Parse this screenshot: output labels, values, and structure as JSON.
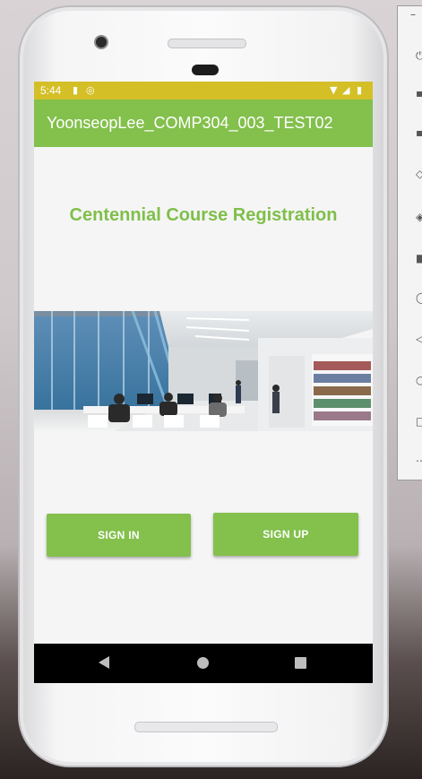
{
  "status_bar": {
    "time": "5:44",
    "icons": [
      "sd-card-icon",
      "sync-icon",
      "wifi-icon",
      "signal-icon",
      "battery-icon"
    ],
    "color": "#d4bf27"
  },
  "app_bar": {
    "title": "YoonseopLee_COMP304_003_TEST02",
    "color": "#83c04c"
  },
  "main": {
    "heading": "Centennial Course Registration",
    "heading_color": "#7fbf4a",
    "hero_image": "library-photo",
    "buttons": {
      "sign_in": "SIGN IN",
      "sign_up": "SIGN UP"
    }
  },
  "navigation": {
    "icons": [
      "back-icon",
      "home-icon",
      "recents-icon"
    ]
  },
  "emulator_toolbar": {
    "icons": [
      "power-icon",
      "volume-up-icon",
      "volume-down-icon",
      "rotate-left-icon",
      "rotate-right-icon",
      "camera-icon",
      "zoom-icon",
      "back-icon",
      "home-icon",
      "overview-icon",
      "more-icon"
    ]
  }
}
